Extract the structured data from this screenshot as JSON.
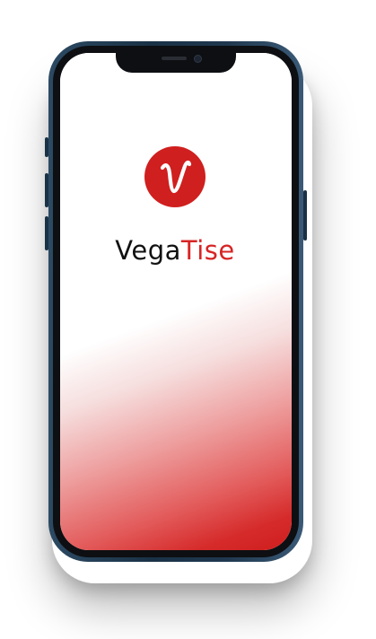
{
  "app": {
    "brand_prefix": "Vega",
    "brand_suffix": "Tise",
    "logo_icon": "vegatise-v-logo-icon"
  },
  "colors": {
    "accent": "#d01f1f",
    "text": "#111111",
    "frame": "#1a3246"
  }
}
